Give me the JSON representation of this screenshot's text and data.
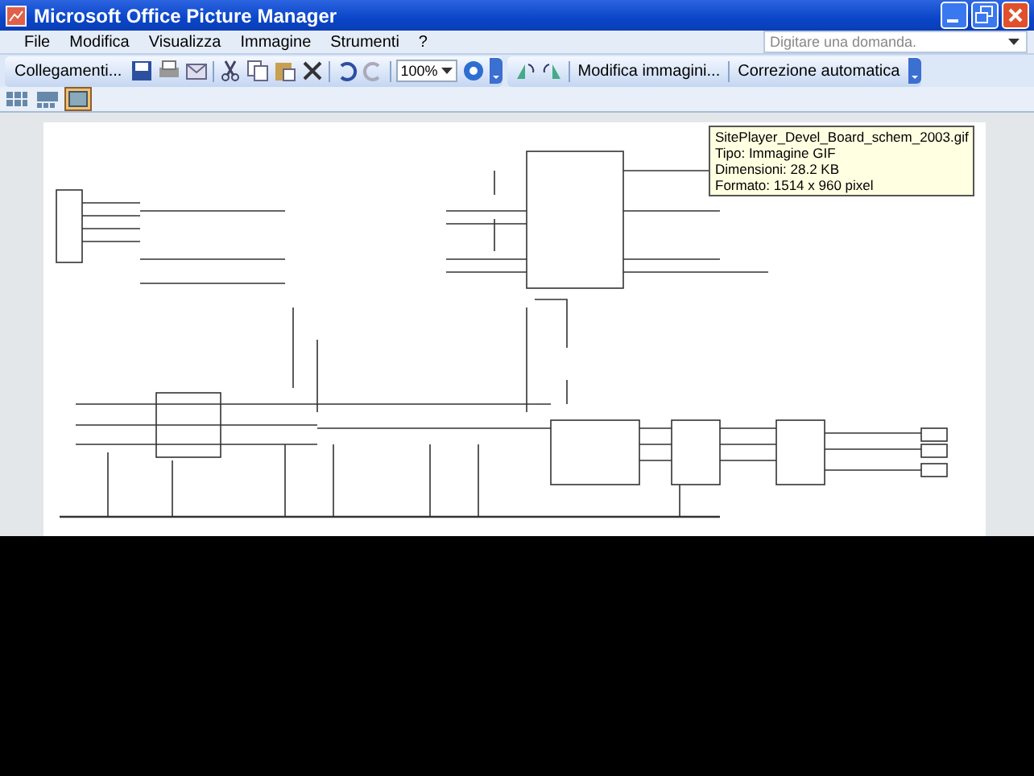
{
  "window": {
    "title": "Microsoft Office Picture Manager"
  },
  "menu": [
    "File",
    "Modifica",
    "Visualizza",
    "Immagine",
    "Strumenti",
    "?"
  ],
  "help_search": {
    "placeholder": "Digitare una domanda."
  },
  "toolbar": {
    "shortcuts": "Collegamenti...",
    "zoom": "100%",
    "edit": "Modifica immagini...",
    "autocorrect": "Correzione automatica"
  },
  "view_buttons": [
    {
      "selected": false
    },
    {
      "selected": false
    },
    {
      "selected": true
    }
  ],
  "tooltip": [
    "SitePlayer_Devel_Board_schem_2003.gif",
    "Tipo: Immagine GIF",
    "Dimensioni: 28.2 KB",
    "Formato: 1514 x 960 pixel"
  ]
}
